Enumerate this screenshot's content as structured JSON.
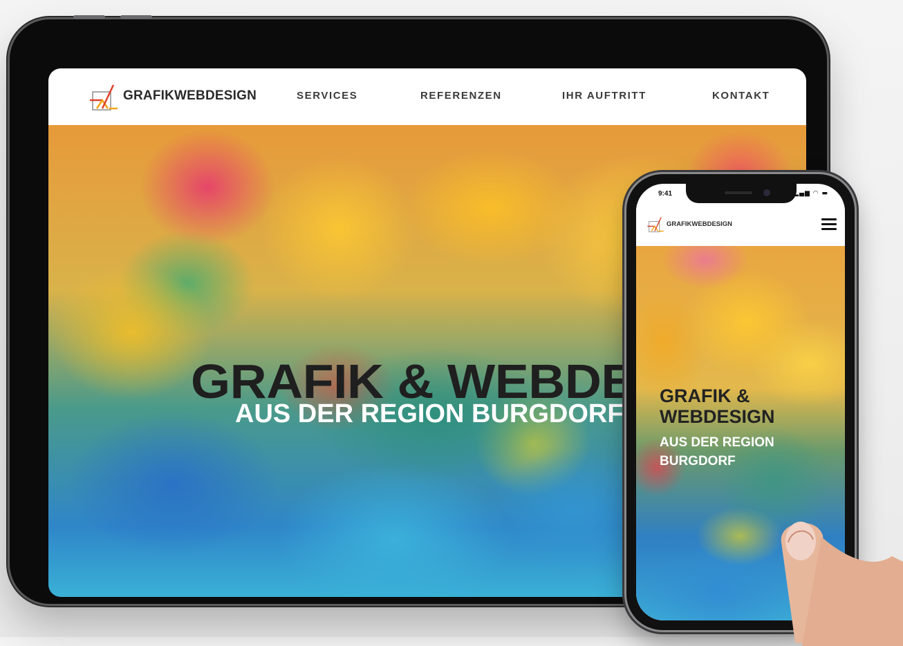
{
  "tablet": {
    "logo_text": "GRAFIKWEBDESIGN",
    "nav": [
      "SERVICES",
      "REFERENZEN",
      "IHR AUFTRITT",
      "KONTAKT"
    ],
    "hero_title": "GRAFIK & WEBDESIGN",
    "hero_subtitle": "AUS DER REGION BURGDORF"
  },
  "phone": {
    "status_time": "9:41",
    "status_icons": "▂▄▆ ◠ ▬",
    "logo_text": "GRAFIKWEBDESIGN",
    "hero_title_line1": "GRAFIK &",
    "hero_title_line2": "WEBDESIGN",
    "hero_subtitle_line1": "AUS DER REGION",
    "hero_subtitle_line2": "BURGDORF",
    "menu_icon": "hamburger-icon"
  },
  "colors": {
    "logo_orange": "#f2a417",
    "logo_red": "#e0402a",
    "dark_text": "#1f1f1f",
    "white": "#ffffff"
  }
}
